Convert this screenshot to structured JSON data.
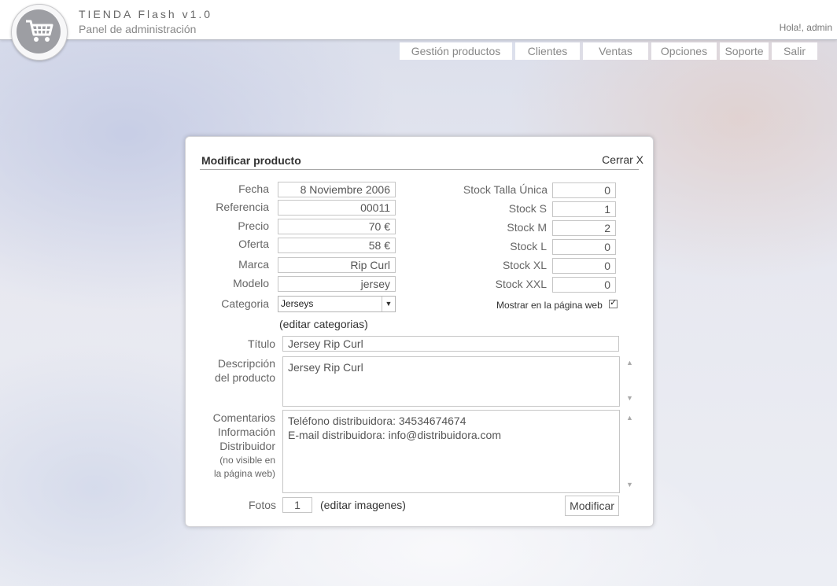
{
  "app": {
    "title": "TIENDA Flash v1.0",
    "subtitle": "Panel de administración",
    "greeting": "Hola!, admin",
    "logo_icon": "shopping-cart-icon"
  },
  "nav": [
    {
      "label": "Gestión productos"
    },
    {
      "label": "Clientes"
    },
    {
      "label": "Ventas"
    },
    {
      "label": "Opciones"
    },
    {
      "label": "Soporte"
    },
    {
      "label": "Salir"
    }
  ],
  "panel": {
    "title": "Modificar producto",
    "close_label": "Cerrar X"
  },
  "form": {
    "fecha_label": "Fecha",
    "fecha_value": "8 Noviembre 2006",
    "referencia_label": "Referencia",
    "referencia_value": "00011",
    "precio_label": "Precio",
    "precio_value": "70  €",
    "oferta_label": "Oferta",
    "oferta_value": "58  €",
    "marca_label": "Marca",
    "marca_value": "Rip Curl",
    "modelo_label": "Modelo",
    "modelo_value": "jersey",
    "categoria_label": "Categoria",
    "categoria_value": "Jerseys",
    "editar_categorias": "(editar categorias)",
    "titulo_label": "Título",
    "titulo_value": "Jersey Rip Curl",
    "descripcion_label_1": "Descripción",
    "descripcion_label_2": "del producto",
    "descripcion_value": "Jersey Rip Curl",
    "comentarios_label_1": "Comentarios",
    "comentarios_label_2": "Información",
    "comentarios_label_3": "Distribuidor",
    "comentarios_note_1": "(no visible en",
    "comentarios_note_2": "la página web)",
    "comentarios_line_1": "Teléfono distribuidora: 34534674674",
    "comentarios_line_2": "E-mail distribuidora: info@distribuidora.com",
    "fotos_label": "Fotos",
    "fotos_value": "1",
    "editar_imagenes": "(editar imagenes)",
    "submit_label": "Modificar"
  },
  "stock": {
    "unica_label": "Stock Talla Única",
    "unica_value": "0",
    "s_label": "Stock S",
    "s_value": "1",
    "m_label": "Stock M",
    "m_value": "2",
    "l_label": "Stock L",
    "l_value": "0",
    "xl_label": "Stock XL",
    "xl_value": "0",
    "xxl_label": "Stock XXL",
    "xxl_value": "0",
    "mostrar_label": "Mostrar en la página web",
    "mostrar_checked": true
  }
}
